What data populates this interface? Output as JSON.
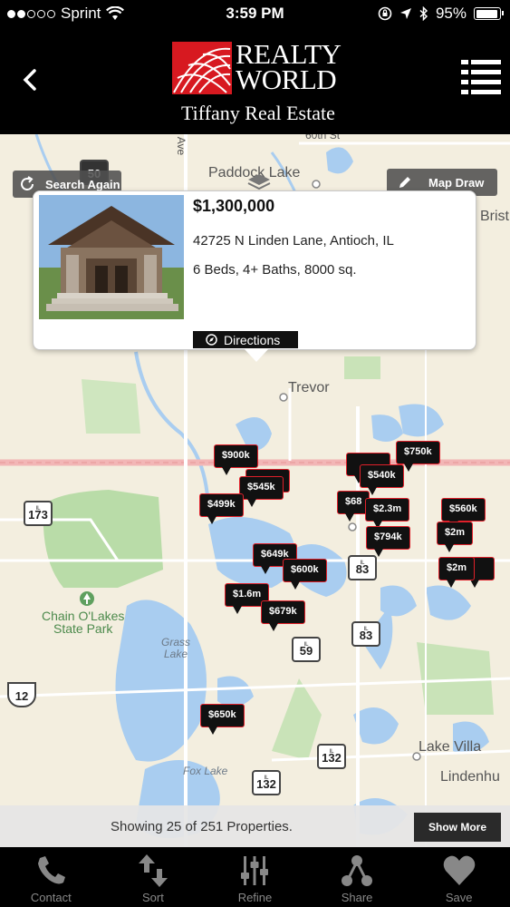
{
  "status_bar": {
    "carrier": "Sprint",
    "time": "3:59 PM",
    "battery": "95%",
    "battery_level": 0.95
  },
  "header": {
    "logo_line1": "REALTY",
    "logo_line2": "WORLD",
    "logo_subtitle": "Tiffany Real Estate",
    "logo_tm": "TM"
  },
  "map": {
    "search_again_label": "Search Again",
    "map_draw_label": "Map Draw",
    "labels": {
      "paddock_lake": "Paddock Lake",
      "bristol": "Brist",
      "trevor": "Trevor",
      "chain_o_lakes": "Chain O'Lakes\nState Park",
      "grass_lake": "Grass\nLake",
      "fox_lake": "Fox Lake",
      "lake_villa": "Lake Villa",
      "lindenhurst": "Lindenhu",
      "st_60": "60th St",
      "ave": "Ave"
    },
    "shields": {
      "s50": "50",
      "s173": "173",
      "s83a": "83",
      "s83b": "83",
      "s59": "59",
      "s12": "12",
      "s132a": "132",
      "s132b": "132",
      "il": "IL"
    }
  },
  "callout": {
    "price": "$1,300,000",
    "address": "42725 N Linden Lane, Antioch, IL",
    "details": "6 Beds, 4+ Baths, 8000 sq.",
    "directions_label": "Directions"
  },
  "markers": [
    {
      "label": "$900k"
    },
    {
      "label": "$545k"
    },
    {
      "label": "$499k"
    },
    {
      "label": "$649k"
    },
    {
      "label": "$600k"
    },
    {
      "label": "$1.6m"
    },
    {
      "label": "$679k"
    },
    {
      "label": "$650k"
    },
    {
      "label": "$750k"
    },
    {
      "label": "$540k"
    },
    {
      "label": "$68"
    },
    {
      "label": "$2.3m"
    },
    {
      "label": "$794k"
    },
    {
      "label": "$560k"
    },
    {
      "label": "$2m"
    },
    {
      "label": "$2m"
    }
  ],
  "banner": {
    "text": "Showing 25 of 251 Properties.",
    "button": "Show More"
  },
  "tabs": [
    {
      "label": "Contact",
      "icon": "phone-icon"
    },
    {
      "label": "Sort",
      "icon": "sort-arrows-icon"
    },
    {
      "label": "Refine",
      "icon": "sliders-icon"
    },
    {
      "label": "Share",
      "icon": "share-icon"
    },
    {
      "label": "Save",
      "icon": "heart-icon"
    }
  ],
  "colors": {
    "brand_red": "#d71920",
    "marker_border": "#e0202a",
    "map_bg": "#f3eedf",
    "water": "#a9cdf0",
    "park": "#b9dca8"
  }
}
